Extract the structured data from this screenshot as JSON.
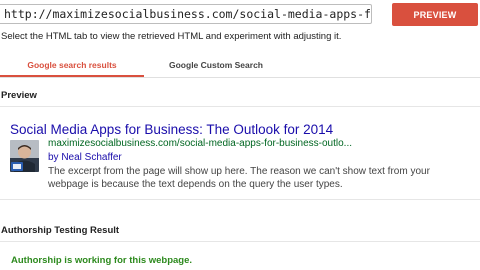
{
  "url_field": {
    "value": "http://maximizesocialbusiness.com/social-media-apps-for-business-outlook-"
  },
  "preview_button": {
    "label": "PREVIEW",
    "color": "#d9503e"
  },
  "instructions": "Select the HTML tab to view the retrieved HTML and experiment with adjusting it.",
  "tabs": [
    {
      "label": "Google search results",
      "active": true
    },
    {
      "label": "Google Custom Search",
      "active": false
    }
  ],
  "preview": {
    "heading": "Preview",
    "result": {
      "title": "Social Media Apps for Business: The Outlook for 2014",
      "url": "maximizesocialbusiness.com/social-media-apps-for-business-outlo...",
      "author": "by Neal Schaffer",
      "snippet": "The excerpt from the page will show up here. The reason we can't show text from your webpage is because the text depends on the query the user types."
    }
  },
  "authorship": {
    "heading": "Authorship Testing Result",
    "status": "Authorship is working for this webpage.",
    "status_color": "#2d8a1e"
  }
}
